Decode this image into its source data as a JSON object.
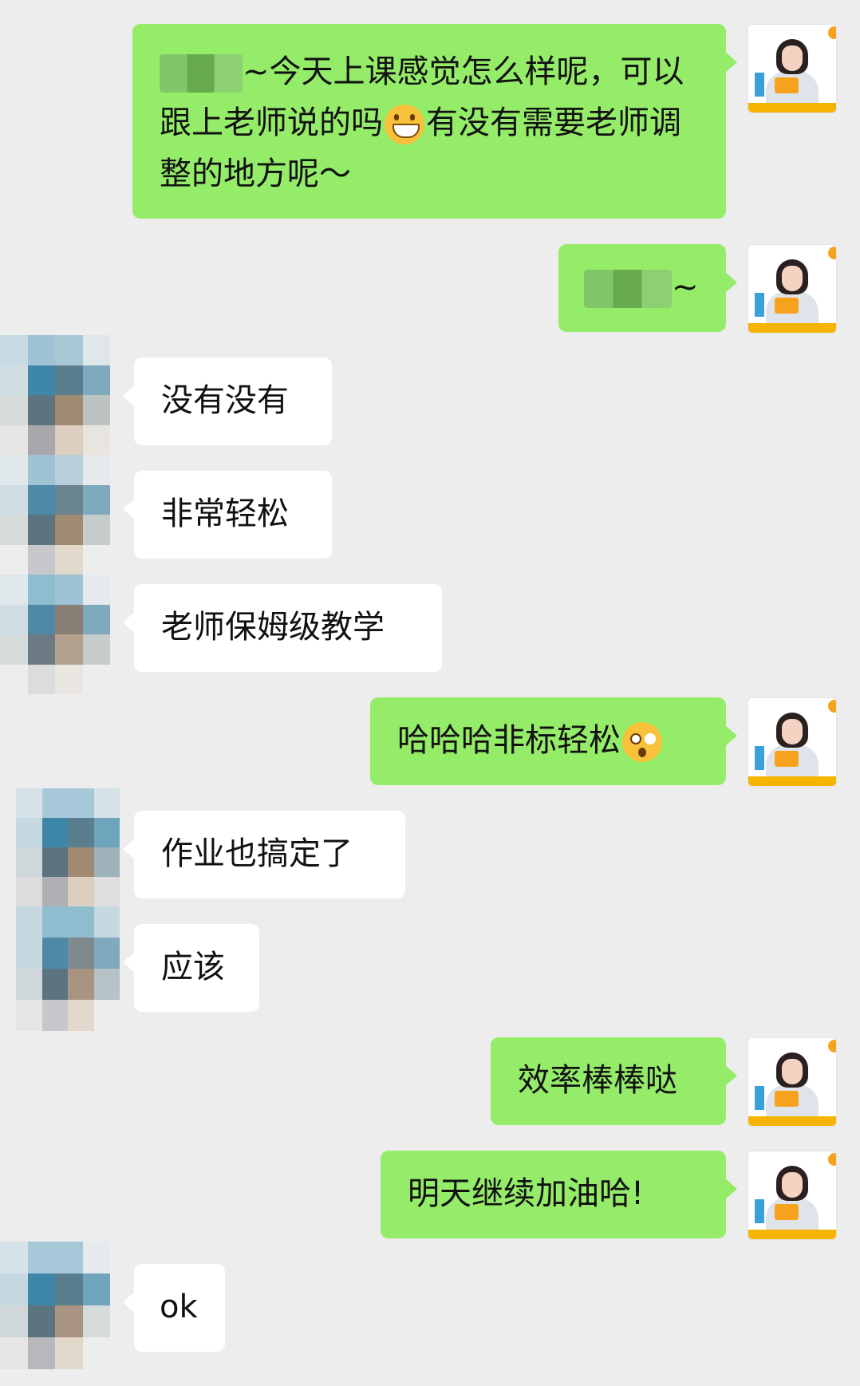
{
  "messages": [
    {
      "side": "me",
      "prefix_redacted": true,
      "text_a": "~今天上课感觉怎么样呢，可以跟上老师说的吗",
      "emoji": "grin-icon",
      "text_b": "有没有需要老师调整的地方呢～"
    },
    {
      "side": "me",
      "prefix_redacted": true,
      "text": "~"
    },
    {
      "side": "them",
      "text": "没有没有"
    },
    {
      "side": "them",
      "text": "非常轻松"
    },
    {
      "side": "them",
      "text": "老师保姆级教学"
    },
    {
      "side": "me",
      "text": "哈哈哈非标轻松",
      "emoji": "shocked-icon"
    },
    {
      "side": "them",
      "text": "作业也搞定了"
    },
    {
      "side": "them",
      "text": "应该"
    },
    {
      "side": "me",
      "text": "效率棒棒哒"
    },
    {
      "side": "me",
      "text": "明天继续加油哈!"
    },
    {
      "side": "them",
      "text": "ok"
    }
  ],
  "colors": {
    "background": "#ededed",
    "sent_bubble": "#95ec69",
    "received_bubble": "#ffffff"
  },
  "icons": {
    "teacher_avatar": "teacher-avatar-icon",
    "student_avatar": "pixelated-avatar-icon"
  }
}
